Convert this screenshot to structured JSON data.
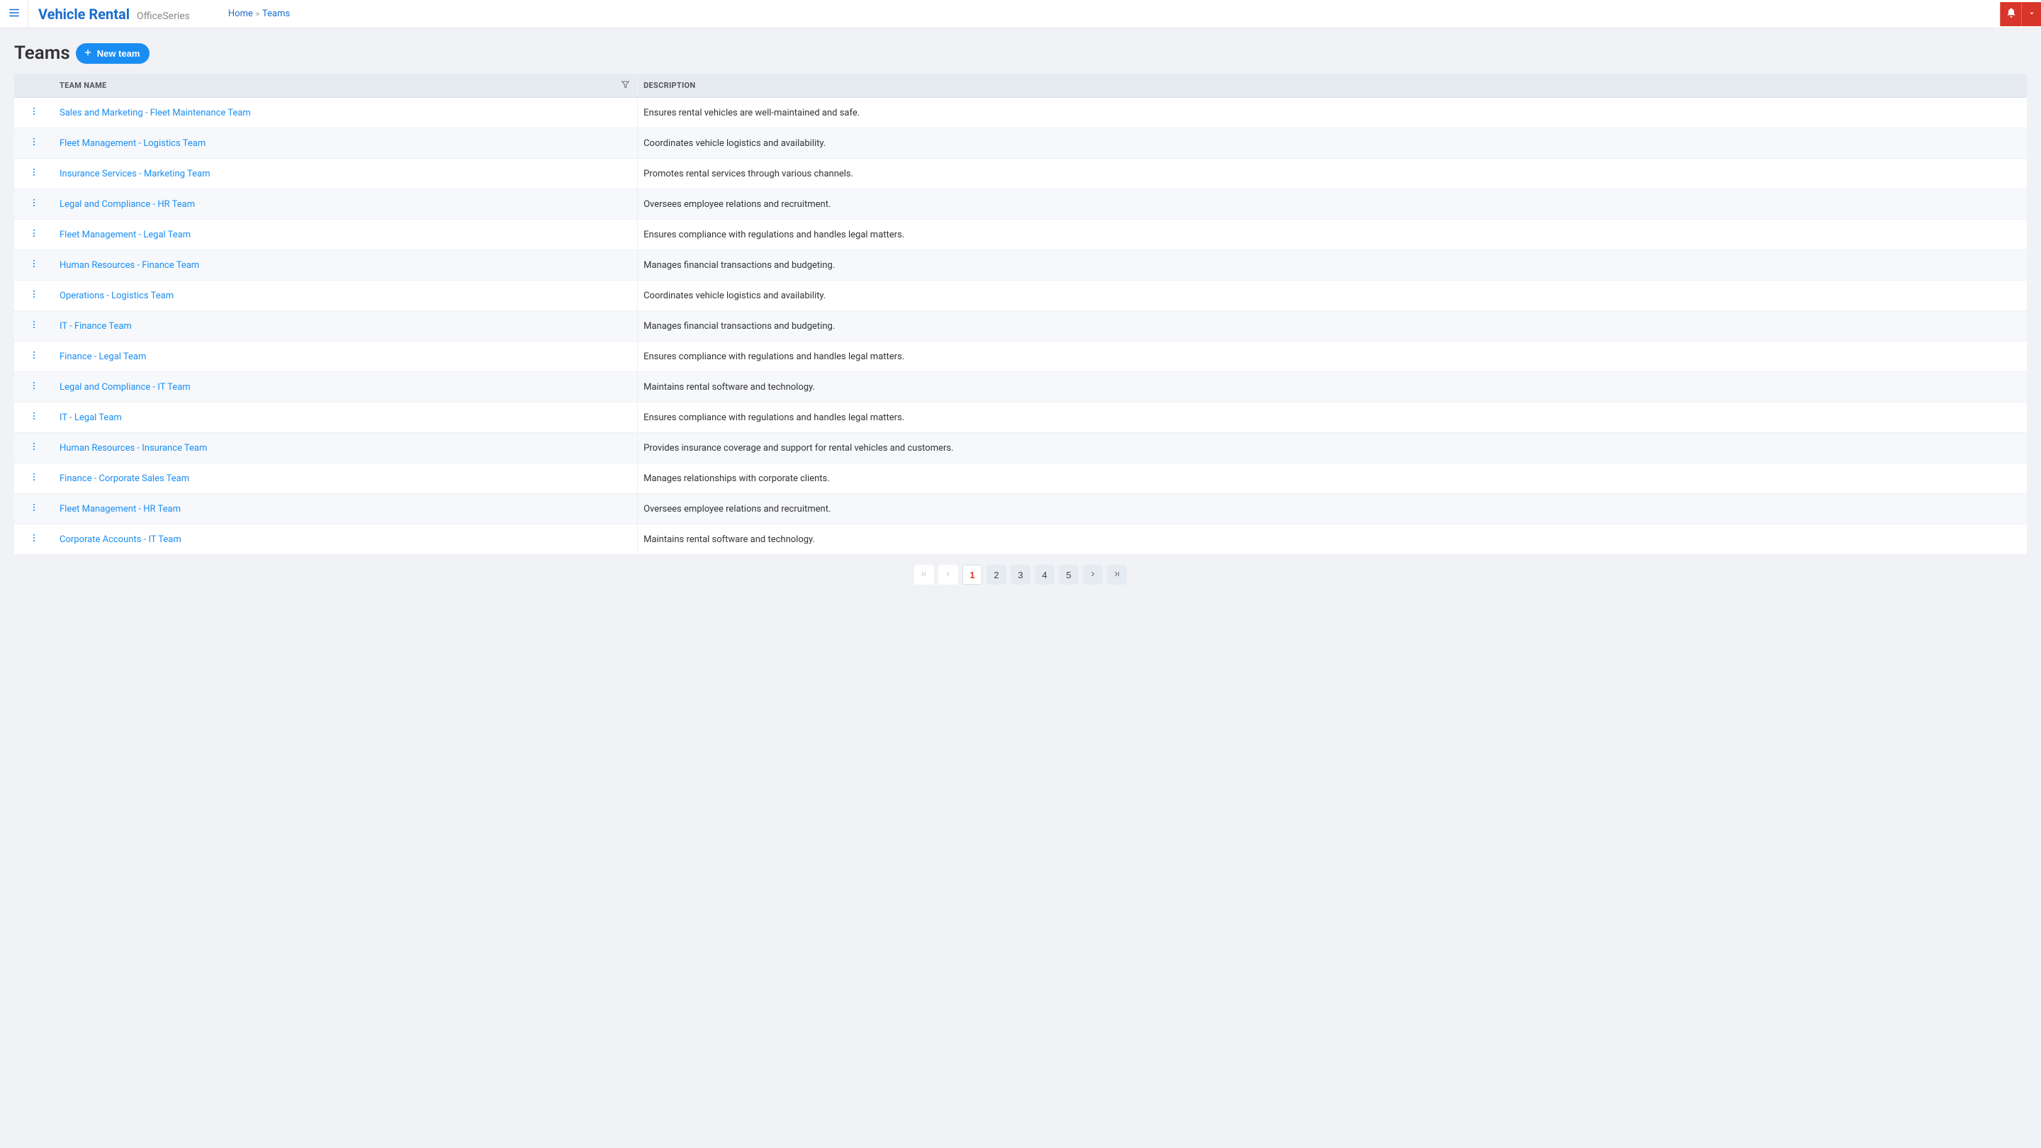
{
  "header": {
    "brand_title": "Vehicle Rental",
    "brand_sub": "OfficeSeries",
    "breadcrumb_home": "Home",
    "breadcrumb_sep": "»",
    "breadcrumb_current": "Teams"
  },
  "page": {
    "title": "Teams",
    "new_button_label": "New team"
  },
  "table": {
    "col_name": "Team Name",
    "col_desc": "Description",
    "rows": [
      {
        "name": "Sales and Marketing - Fleet Maintenance Team",
        "desc": "Ensures rental vehicles are well-maintained and safe."
      },
      {
        "name": "Fleet Management - Logistics Team",
        "desc": "Coordinates vehicle logistics and availability."
      },
      {
        "name": "Insurance Services - Marketing Team",
        "desc": "Promotes rental services through various channels."
      },
      {
        "name": "Legal and Compliance - HR Team",
        "desc": "Oversees employee relations and recruitment."
      },
      {
        "name": "Fleet Management - Legal Team",
        "desc": "Ensures compliance with regulations and handles legal matters."
      },
      {
        "name": "Human Resources - Finance Team",
        "desc": "Manages financial transactions and budgeting."
      },
      {
        "name": "Operations - Logistics Team",
        "desc": "Coordinates vehicle logistics and availability."
      },
      {
        "name": "IT - Finance Team",
        "desc": "Manages financial transactions and budgeting."
      },
      {
        "name": "Finance - Legal Team",
        "desc": "Ensures compliance with regulations and handles legal matters."
      },
      {
        "name": "Legal and Compliance - IT Team",
        "desc": "Maintains rental software and technology."
      },
      {
        "name": "IT - Legal Team",
        "desc": "Ensures compliance with regulations and handles legal matters."
      },
      {
        "name": "Human Resources - Insurance Team",
        "desc": "Provides insurance coverage and support for rental vehicles and customers."
      },
      {
        "name": "Finance - Corporate Sales Team",
        "desc": "Manages relationships with corporate clients."
      },
      {
        "name": "Fleet Management - HR Team",
        "desc": "Oversees employee relations and recruitment."
      },
      {
        "name": "Corporate Accounts - IT Team",
        "desc": "Maintains rental software and technology."
      }
    ]
  },
  "pagination": {
    "pages": [
      "1",
      "2",
      "3",
      "4",
      "5"
    ],
    "current": "1"
  }
}
